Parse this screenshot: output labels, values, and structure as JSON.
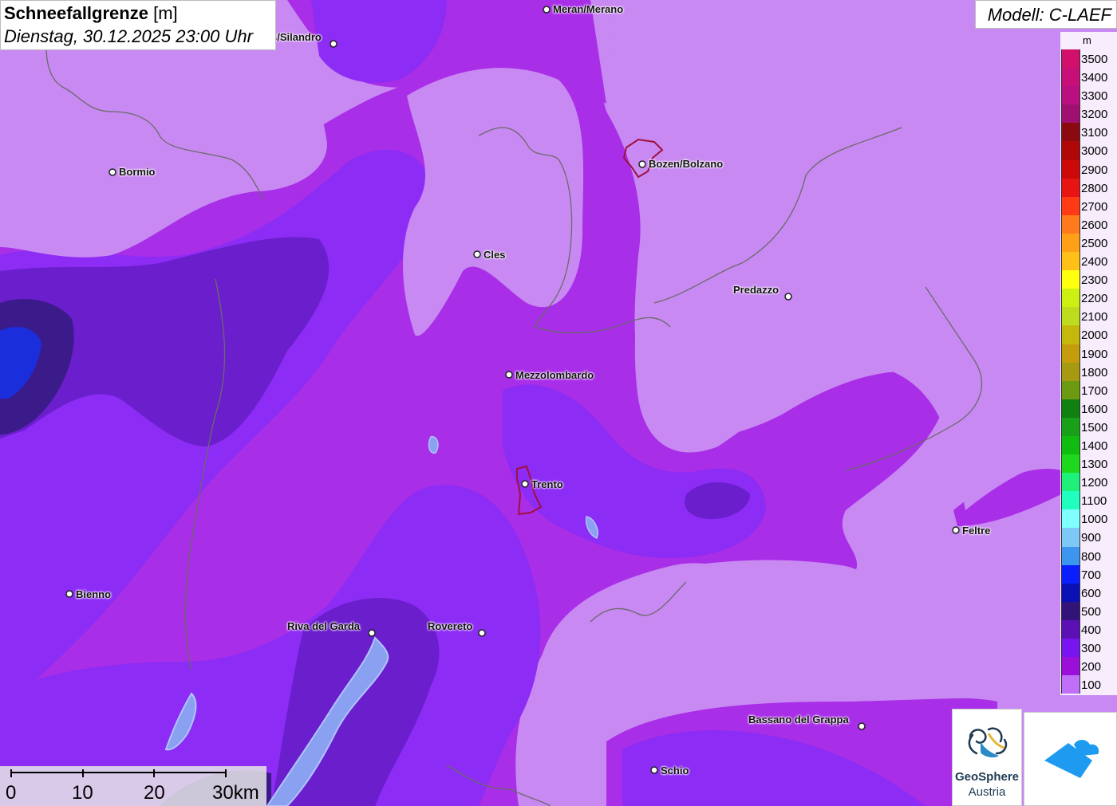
{
  "header": {
    "title": "Schneefallgrenze",
    "unit": "[m]",
    "datetime": "Dienstag, 30.12.2025 23:00 Uhr"
  },
  "model": {
    "label": "Modell: C-LAEF"
  },
  "legend": {
    "unit": "m",
    "items": [
      {
        "label": "3500",
        "color": "#d0106a"
      },
      {
        "label": "3400",
        "color": "#c80f78"
      },
      {
        "label": "3300",
        "color": "#b81080"
      },
      {
        "label": "3200",
        "color": "#a01070"
      },
      {
        "label": "3100",
        "color": "#8a0a10"
      },
      {
        "label": "3000",
        "color": "#b00808"
      },
      {
        "label": "2900",
        "color": "#cc0808"
      },
      {
        "label": "2800",
        "color": "#e81414"
      },
      {
        "label": "2700",
        "color": "#ff3a14"
      },
      {
        "label": "2600",
        "color": "#ff7a1c"
      },
      {
        "label": "2500",
        "color": "#ffa018"
      },
      {
        "label": "2400",
        "color": "#ffc018"
      },
      {
        "label": "2300",
        "color": "#ffff10"
      },
      {
        "label": "2200",
        "color": "#ccf012"
      },
      {
        "label": "2100",
        "color": "#bedc1e"
      },
      {
        "label": "2000",
        "color": "#c4b80c"
      },
      {
        "label": "1900",
        "color": "#c49c0c"
      },
      {
        "label": "1800",
        "color": "#a89a10"
      },
      {
        "label": "1700",
        "color": "#6c9a10"
      },
      {
        "label": "1600",
        "color": "#108010"
      },
      {
        "label": "1500",
        "color": "#18a018"
      },
      {
        "label": "1400",
        "color": "#10bc10"
      },
      {
        "label": "1300",
        "color": "#1ed81e"
      },
      {
        "label": "1200",
        "color": "#1ef07a"
      },
      {
        "label": "1100",
        "color": "#1effc0"
      },
      {
        "label": "1000",
        "color": "#80ffff"
      },
      {
        "label": "900",
        "color": "#7ec8f8"
      },
      {
        "label": "800",
        "color": "#3c96f0"
      },
      {
        "label": "700",
        "color": "#0a1eff"
      },
      {
        "label": "600",
        "color": "#0a10b4"
      },
      {
        "label": "500",
        "color": "#321478"
      },
      {
        "label": "400",
        "color": "#5a10b4"
      },
      {
        "label": "300",
        "color": "#7814f0"
      },
      {
        "label": "200",
        "color": "#9a10d8"
      },
      {
        "label": "100",
        "color": "#c070f8"
      }
    ]
  },
  "cities": [
    {
      "name": "Meran/Merano"
    },
    {
      "name": "s/Silandro"
    },
    {
      "name": "Bormio"
    },
    {
      "name": "Bozen/Bolzano"
    },
    {
      "name": "Cles"
    },
    {
      "name": "Predazzo"
    },
    {
      "name": "Mezzolombardo"
    },
    {
      "name": "Trento"
    },
    {
      "name": "Feltre"
    },
    {
      "name": "Bienno"
    },
    {
      "name": "Riva del Garda"
    },
    {
      "name": "Rovereto"
    },
    {
      "name": "Bassano del Grappa"
    },
    {
      "name": "Schio"
    }
  ],
  "scale": {
    "labels": [
      "0",
      "10",
      "20",
      "30km"
    ]
  },
  "logos": {
    "geosphere_line1": "GeoSphere",
    "geosphere_line2": "Austria"
  }
}
